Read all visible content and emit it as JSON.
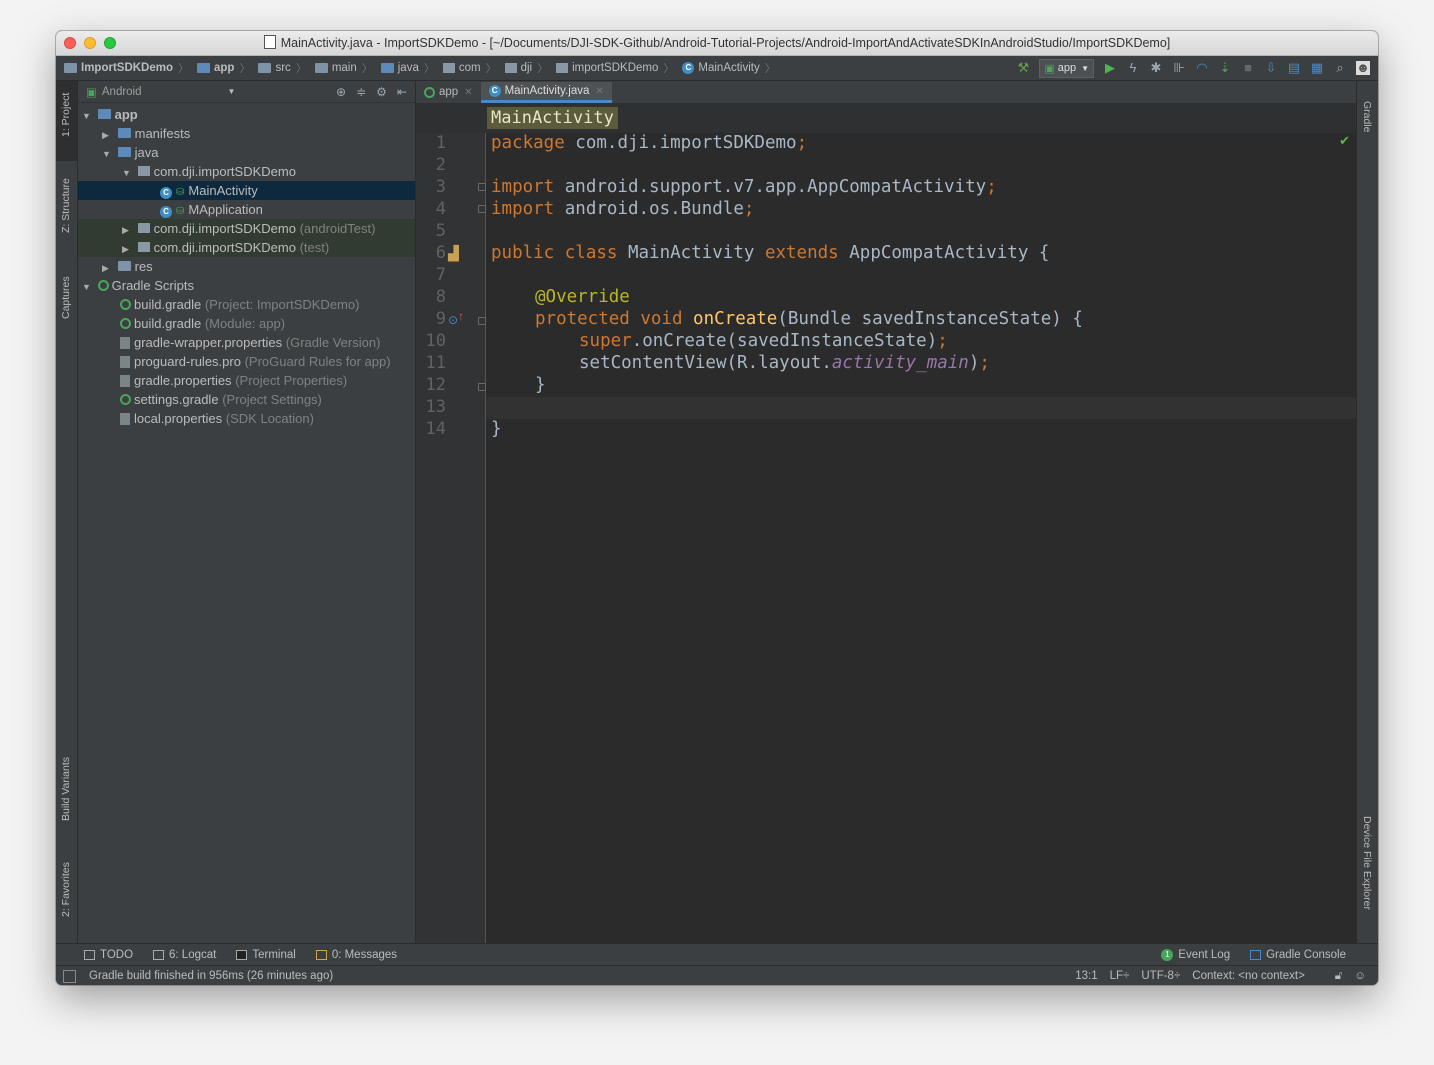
{
  "window": {
    "title": "MainActivity.java - ImportSDKDemo - [~/Documents/DJI-SDK-Github/Android-Tutorial-Projects/Android-ImportAndActivateSDKInAndroidStudio/ImportSDKDemo]"
  },
  "navbar": {
    "crumbs": [
      "ImportSDKDemo",
      "app",
      "src",
      "main",
      "java",
      "com",
      "dji",
      "importSDKDemo",
      "MainActivity"
    ],
    "run_config": "app"
  },
  "left_tabs": {
    "project": "1: Project",
    "structure": "Z: Structure",
    "captures": "Captures",
    "build_variants": "Build Variants",
    "favorites": "2: Favorites"
  },
  "right_tabs": {
    "gradle": "Gradle",
    "device_file_explorer": "Device File Explorer"
  },
  "project_panel": {
    "view_mode": "Android",
    "tree": [
      {
        "label": "app",
        "suffix": ""
      },
      {
        "label": "manifests",
        "suffix": ""
      },
      {
        "label": "java",
        "suffix": ""
      },
      {
        "label": "com.dji.importSDKDemo",
        "suffix": ""
      },
      {
        "label": "MainActivity",
        "suffix": ""
      },
      {
        "label": "MApplication",
        "suffix": ""
      },
      {
        "label": "com.dji.importSDKDemo",
        "suffix": "(androidTest)"
      },
      {
        "label": "com.dji.importSDKDemo",
        "suffix": "(test)"
      },
      {
        "label": "res",
        "suffix": ""
      },
      {
        "label": "Gradle Scripts",
        "suffix": ""
      },
      {
        "label": "build.gradle",
        "suffix": "(Project: ImportSDKDemo)"
      },
      {
        "label": "build.gradle",
        "suffix": "(Module: app)"
      },
      {
        "label": "gradle-wrapper.properties",
        "suffix": "(Gradle Version)"
      },
      {
        "label": "proguard-rules.pro",
        "suffix": "(ProGuard Rules for app)"
      },
      {
        "label": "gradle.properties",
        "suffix": "(Project Properties)"
      },
      {
        "label": "settings.gradle",
        "suffix": "(Project Settings)"
      },
      {
        "label": "local.properties",
        "suffix": "(SDK Location)"
      }
    ]
  },
  "editor": {
    "tabs": [
      {
        "label": "app"
      },
      {
        "label": "MainActivity.java"
      }
    ],
    "breadcrumb": "MainActivity",
    "line_numbers": [
      "1",
      "2",
      "3",
      "4",
      "5",
      "6",
      "7",
      "8",
      "9",
      "10",
      "11",
      "12",
      "13",
      "14"
    ],
    "code": {
      "l1a": "package",
      "l1b": " com.dji.importSDKDemo",
      "l1c": ";",
      "l3a": "import",
      "l3b": " android.support.v7.app.AppCompatActivity",
      "l3c": ";",
      "l4a": "import",
      "l4b": " android.os.Bundle",
      "l4c": ";",
      "l6a": "public class",
      "l6b": " MainActivity ",
      "l6c": "extends",
      "l6d": " AppCompatActivity {",
      "l8": "@Override",
      "l9a": "protected void",
      "l9b": " onCreate",
      "l9c": "(Bundle savedInstanceState) {",
      "l10a": "super",
      "l10b": ".onCreate(savedInstanceState)",
      "l10c": ";",
      "l11a": "setContentView(R.layout.",
      "l11b": "activity_main",
      "l11c": ")",
      "l11d": ";",
      "l12": "}",
      "l14": "}"
    }
  },
  "bottom_tabs": {
    "todo": "TODO",
    "logcat": "6: Logcat",
    "terminal": "Terminal",
    "messages": "0: Messages",
    "event_log": "Event Log",
    "gradle_console": "Gradle Console"
  },
  "status": {
    "message": "Gradle build finished in 956ms (26 minutes ago)",
    "position": "13:1",
    "line_sep": "LF÷",
    "encoding": "UTF-8÷",
    "context": "Context: <no context>"
  },
  "colors": {
    "keyword": "#cc7832",
    "annotation": "#bbb529",
    "method": "#ffc66d",
    "field": "#9876aa",
    "text": "#a9b7c6",
    "selection": "#0d293e"
  }
}
